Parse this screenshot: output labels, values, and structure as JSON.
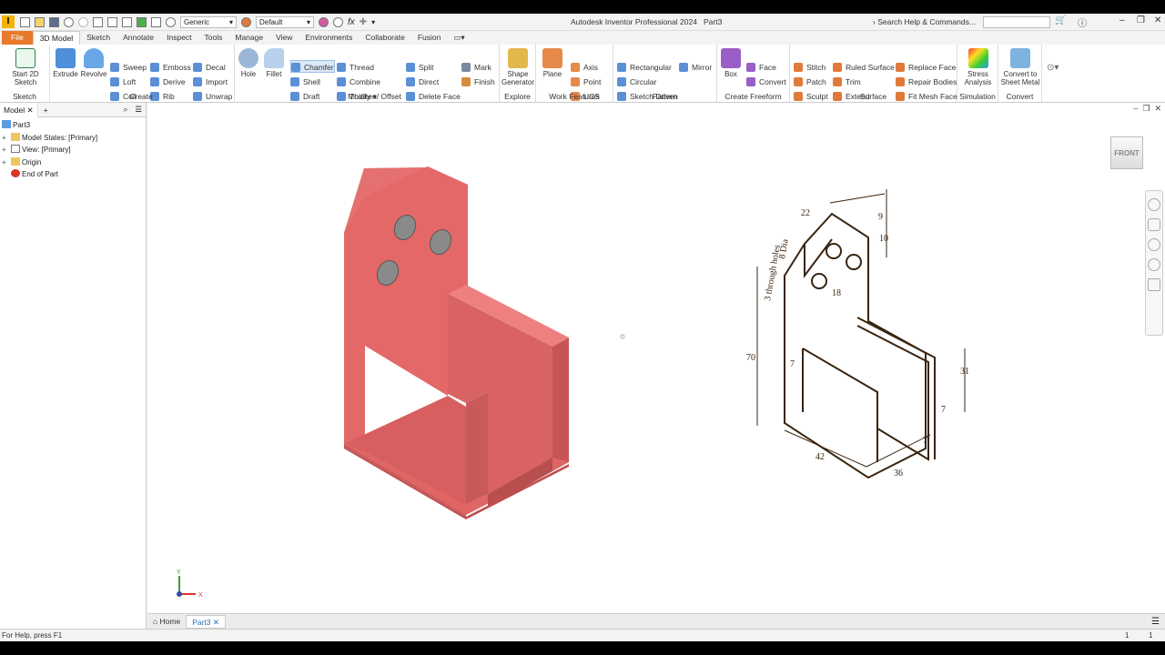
{
  "app": {
    "title": "Autodesk Inventor Professional 2024",
    "document": "Part3",
    "logo": "I",
    "appearance_value": "Generic",
    "material_value": "Default",
    "search_placeholder": "Search Help & Commands...",
    "fx": "fx"
  },
  "tabs": [
    "File",
    "3D Model",
    "Sketch",
    "Annotate",
    "Inspect",
    "Tools",
    "Manage",
    "View",
    "Environments",
    "Collaborate",
    "Fusion"
  ],
  "ribbon": {
    "sketch": {
      "title": "Sketch",
      "start": "Start 2D Sketch"
    },
    "create": {
      "title": "Create",
      "extrude": "Extrude",
      "revolve": "Revolve",
      "sweep": "Sweep",
      "loft": "Loft",
      "coil": "Coil",
      "emboss": "Emboss",
      "derive": "Derive",
      "rib": "Rib",
      "decal": "Decal",
      "import": "Import",
      "unwrap": "Unwrap"
    },
    "modify": {
      "title": "Modify",
      "hole": "Hole",
      "fillet": "Fillet",
      "chamfer": "Chamfer",
      "shell": "Shell",
      "draft": "Draft",
      "thread": "Thread",
      "combine": "Combine",
      "thicken": "Thicken/ Offset",
      "split": "Split",
      "direct": "Direct",
      "delete_face": "Delete Face"
    },
    "modify_extra": {
      "mark": "Mark",
      "finish": "Finish"
    },
    "explore": {
      "title": "Explore",
      "shape_generator": "Shape Generator"
    },
    "work_features": {
      "title": "Work Features",
      "plane": "Plane",
      "axis": "Axis",
      "point": "Point",
      "ucs": "UCS"
    },
    "pattern": {
      "title": "Pattern",
      "rectangular": "Rectangular",
      "circular": "Circular",
      "sketch_driven": "Sketch Driven",
      "mirror": "Mirror"
    },
    "freeform": {
      "title": "Create Freeform",
      "box": "Box",
      "face": "Face",
      "convert": "Convert"
    },
    "surface": {
      "title": "Surface",
      "stitch": "Stitch",
      "patch": "Patch",
      "sculpt": "Sculpt",
      "ruled_surface": "Ruled Surface",
      "trim": "Trim",
      "extend": "Extend",
      "replace_face": "Replace Face",
      "repair_bodies": "Repair Bodies",
      "fit_mesh_face": "Fit Mesh Face"
    },
    "simulation": {
      "title": "Simulation",
      "stress": "Stress Analysis"
    },
    "convert": {
      "title": "Convert",
      "sheet_metal": "Convert to Sheet Metal"
    }
  },
  "browser": {
    "tab": "Model",
    "items": [
      {
        "label": "Part3",
        "expander": ""
      },
      {
        "label": "Model States: [Primary]",
        "expander": "+"
      },
      {
        "label": "View: [Primary]",
        "expander": "+"
      },
      {
        "label": "Origin",
        "expander": "+"
      },
      {
        "label": "End of Part",
        "expander": ""
      }
    ]
  },
  "graphics": {
    "viewcube": "FRONT",
    "triad": {
      "x": "X",
      "y": "Y"
    },
    "drawing_dims": {
      "d22": "22",
      "d9": "9",
      "d10": "10",
      "d18": "18",
      "d70": "70",
      "d7a": "7",
      "d31": "31",
      "d7b": "7",
      "d7c": "7",
      "d42": "42",
      "d36": "36",
      "note1": "3 through holes",
      "note2": "8 Dia"
    }
  },
  "doc_tabs": {
    "home": "Home",
    "part": "Part3"
  },
  "status": {
    "help": "For Help, press F1",
    "count1": "1",
    "count2": "1"
  },
  "colors": {
    "accent": "#e8792b",
    "part": "#e86d6d",
    "part_dark": "#c95858",
    "hole": "#8a8a8a"
  }
}
